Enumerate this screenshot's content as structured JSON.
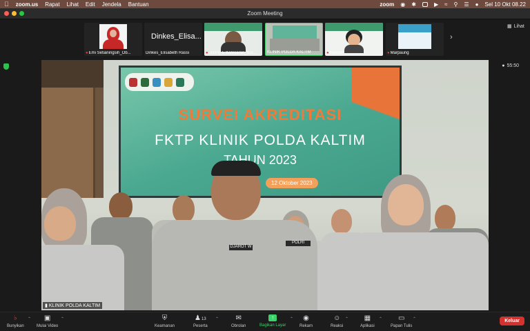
{
  "menubar": {
    "app": "zoom.us",
    "items": [
      "Rapat",
      "Lihat",
      "Edit",
      "Jendela",
      "Bantuan"
    ],
    "logo": "zoom",
    "clock": "Sel 10 Okt  08.22"
  },
  "window": {
    "title": "Zoom Meeting"
  },
  "participants": [
    {
      "name": "Emi Setianingsih_Ob...",
      "muted": true
    },
    {
      "name": "Dinkes_Elisabeth Rassi",
      "big_name": "Dinkes_Elisa...",
      "muted": false
    },
    {
      "name": "Jimmy E Kalesaran_Sur...",
      "muted": true
    },
    {
      "name": "KLINIK POLDA KALTIM",
      "muted": false
    },
    {
      "name": "Nandar",
      "muted": true
    },
    {
      "name": "Marpaung",
      "muted": true
    }
  ],
  "view_button": "Lihat",
  "timer": "55:50",
  "main_video": {
    "label": "KLINIK POLDA KALTIM",
    "banner": {
      "line1": "SURVEI AKREDITASI",
      "line2": "FKTP KLINIK POLDA KALTIM",
      "line3": "TAHUN 2023",
      "date": "12 Oktober 2023"
    },
    "name_plate": "DJAROT W",
    "polri_plate": "POLRI"
  },
  "toolbar": {
    "items": [
      {
        "label": "Bunyikan",
        "icon": "mic-muted-icon"
      },
      {
        "label": "Mulai Video",
        "icon": "video-off-icon"
      },
      {
        "label": "Keamanan",
        "icon": "shield-icon"
      },
      {
        "label": "Peserta",
        "icon": "participants-icon",
        "count": "13"
      },
      {
        "label": "Obrolan",
        "icon": "chat-icon"
      },
      {
        "label": "Bagikan Layar",
        "icon": "share-screen-icon"
      },
      {
        "label": "Rekam",
        "icon": "record-icon"
      },
      {
        "label": "Reaksi",
        "icon": "reaction-icon"
      },
      {
        "label": "Aplikasi",
        "icon": "apps-icon"
      },
      {
        "label": "Papan Tulis",
        "icon": "whiteboard-icon"
      }
    ],
    "leave": "Keluar"
  },
  "colors": {
    "menubar_bg": "#6e4a3e",
    "share_green": "#3dd06a",
    "leave_red": "#d3322f",
    "muted_red": "#e0403a"
  }
}
